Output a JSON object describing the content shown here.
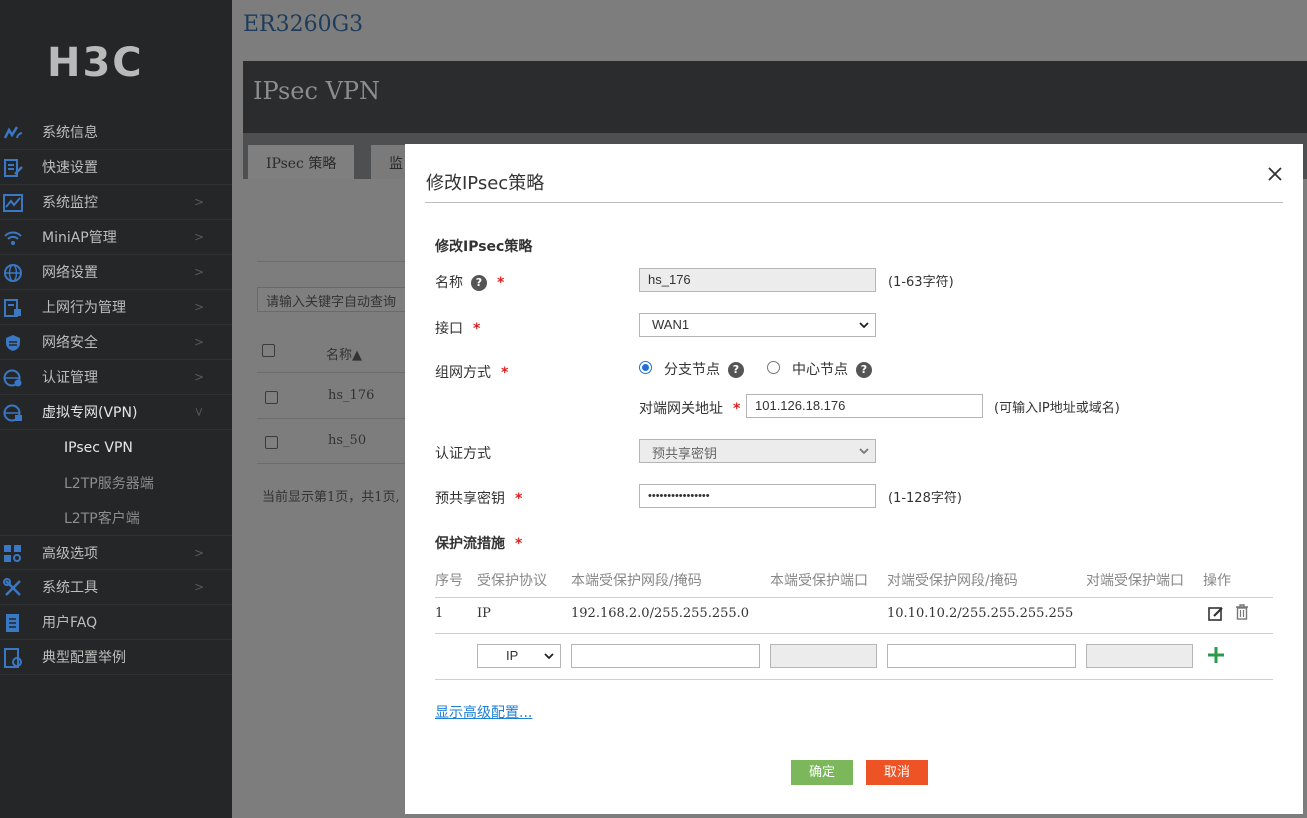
{
  "sidebar": {
    "logo": "H3C",
    "items": [
      {
        "label": "系统信息"
      },
      {
        "label": "快速设置"
      },
      {
        "label": "系统监控"
      },
      {
        "label": "MiniAP管理"
      },
      {
        "label": "网络设置"
      },
      {
        "label": "上网行为管理"
      },
      {
        "label": "网络安全"
      },
      {
        "label": "认证管理"
      },
      {
        "label": "虚拟专网(VPN)"
      }
    ],
    "subitems": [
      {
        "label": "IPsec VPN"
      },
      {
        "label": "L2TP服务器端"
      },
      {
        "label": "L2TP客户端"
      }
    ],
    "items2": [
      {
        "label": "高级选项"
      },
      {
        "label": "系统工具"
      },
      {
        "label": "用户FAQ"
      },
      {
        "label": "典型配置举例"
      }
    ]
  },
  "header": {
    "device": "ER3260G3",
    "page_title": "IPsec VPN",
    "tabs": [
      {
        "label": "IPsec 策略"
      },
      {
        "label": "监"
      }
    ]
  },
  "background": {
    "search_placeholder": "请输入关键字自动查询",
    "col_name": "名称▲",
    "rows": [
      "hs_176",
      "hs_50"
    ],
    "pager": "当前显示第1页，共1页,"
  },
  "modal": {
    "title": "修改IPsec策略",
    "section_title": "修改IPsec策略",
    "name_label": "名称",
    "name_value": "hs_176",
    "name_hint": "(1-63字符)",
    "interface_label": "接口",
    "interface_value": "WAN1",
    "network_mode_label": "组网方式",
    "mode_branch": "分支节点",
    "mode_center": "中心节点",
    "peer_gateway_label": "对端网关地址",
    "peer_gateway_value": "101.126.18.176",
    "peer_gateway_hint": "(可输入IP地址或域名)",
    "auth_label": "认证方式",
    "auth_value": "预共享密钥",
    "psk_label": "预共享密钥",
    "psk_value": "••••••••••••••••",
    "psk_hint": "(1-128字符)",
    "protect_title": "保护流措施",
    "table_headers": [
      "序号",
      "受保护协议",
      "本端受保护网段/掩码",
      "本端受保护端口",
      "对端受保护网段/掩码",
      "对端受保护端口",
      "操作"
    ],
    "rows": [
      {
        "seq": "1",
        "proto": "IP",
        "local": "192.168.2.0/255.255.255.0",
        "local_port": "",
        "remote": "10.10.10.2/255.255.255.255",
        "remote_port": ""
      }
    ],
    "new_row_proto": "IP",
    "advanced_link": "显示高级配置...",
    "ok_label": "确定",
    "cancel_label": "取消"
  },
  "colors": {
    "sidebar_bg": "#242628",
    "ok": "#7cb75c",
    "cancel": "#ee5325",
    "required": "#e02020",
    "link": "#1e7fd6"
  }
}
